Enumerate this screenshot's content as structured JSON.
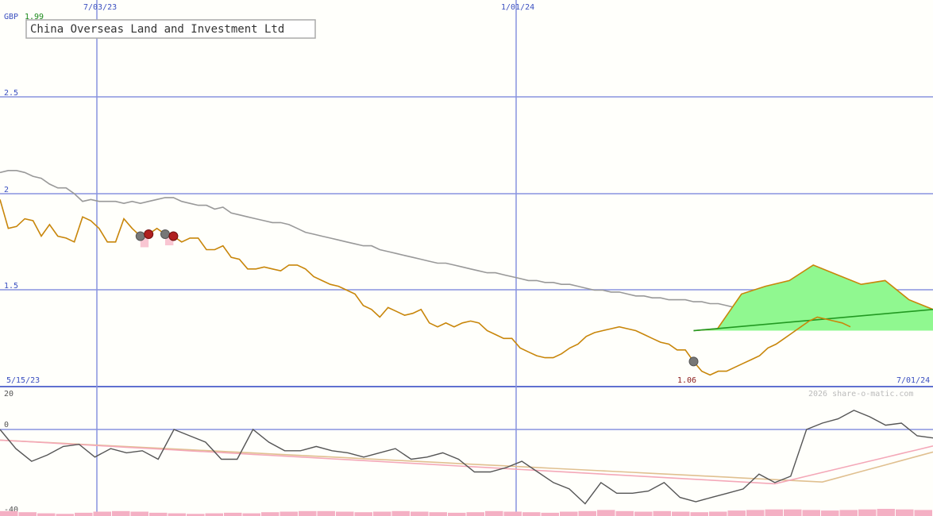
{
  "chart_data": {
    "type": "line",
    "title": "China Overseas Land and Investment Ltd",
    "currency": "GBP",
    "last_value_label": "1.99",
    "low_value_label": "1.06",
    "watermark": "2026 share-o-matic.com",
    "x_range": [
      "5/15/23",
      "7/01/24"
    ],
    "x_gridlines": [
      "7/03/23",
      "1/01/24"
    ],
    "y_ticks": [
      "2.5",
      "2",
      "1.5"
    ],
    "y_range": [
      1.0,
      2.95
    ],
    "oscillator": {
      "ticks": [
        "20",
        "0",
        "-40"
      ],
      "range": [
        -40,
        20
      ]
    },
    "colors": {
      "price": "#c8860a",
      "moving_average": "#999999",
      "forecast_fill": "#90f890",
      "trend_line": "#229922",
      "osc_fast": "#555555",
      "osc_pink": "#f4a8b8",
      "osc_tan": "#e0c090",
      "volume": "#f4b0c4",
      "grid": "#8894e0"
    },
    "series": [
      {
        "name": "price",
        "values": [
          1.97,
          1.82,
          1.83,
          1.87,
          1.86,
          1.78,
          1.84,
          1.78,
          1.77,
          1.75,
          1.88,
          1.86,
          1.82,
          1.75,
          1.75,
          1.87,
          1.82,
          1.78,
          1.79,
          1.82,
          1.79,
          1.78,
          1.75,
          1.77,
          1.77,
          1.71,
          1.71,
          1.73,
          1.67,
          1.66,
          1.61,
          1.61,
          1.62,
          1.61,
          1.6,
          1.63,
          1.63,
          1.61,
          1.57,
          1.55,
          1.53,
          1.52,
          1.5,
          1.48,
          1.42,
          1.4,
          1.36,
          1.41,
          1.39,
          1.37,
          1.38,
          1.4,
          1.33,
          1.31,
          1.33,
          1.31,
          1.33,
          1.34,
          1.33,
          1.29,
          1.27,
          1.25,
          1.25,
          1.2,
          1.18,
          1.16,
          1.15,
          1.15,
          1.17,
          1.2,
          1.22,
          1.26,
          1.28,
          1.29,
          1.3,
          1.31,
          1.3,
          1.29,
          1.27,
          1.25,
          1.23,
          1.22,
          1.19,
          1.19,
          1.13,
          1.08,
          1.06,
          1.08,
          1.08,
          1.1,
          1.12,
          1.14,
          1.16,
          1.2,
          1.22,
          1.25,
          1.28,
          1.31,
          1.34,
          1.36,
          1.35,
          1.34,
          1.33,
          1.31
        ]
      },
      {
        "name": "moving_average",
        "values": [
          2.11,
          2.12,
          2.12,
          2.11,
          2.09,
          2.08,
          2.05,
          2.03,
          2.03,
          2.0,
          1.96,
          1.97,
          1.96,
          1.96,
          1.96,
          1.95,
          1.96,
          1.95,
          1.96,
          1.97,
          1.98,
          1.98,
          1.96,
          1.95,
          1.94,
          1.94,
          1.92,
          1.93,
          1.9,
          1.89,
          1.88,
          1.87,
          1.86,
          1.85,
          1.85,
          1.84,
          1.82,
          1.8,
          1.79,
          1.78,
          1.77,
          1.76,
          1.75,
          1.74,
          1.73,
          1.73,
          1.71,
          1.7,
          1.69,
          1.68,
          1.67,
          1.66,
          1.65,
          1.64,
          1.64,
          1.63,
          1.62,
          1.61,
          1.6,
          1.59,
          1.59,
          1.58,
          1.57,
          1.56,
          1.55,
          1.55,
          1.54,
          1.54,
          1.53,
          1.53,
          1.52,
          1.51,
          1.5,
          1.5,
          1.49,
          1.49,
          1.48,
          1.47,
          1.47,
          1.46,
          1.46,
          1.45,
          1.45,
          1.45,
          1.44,
          1.44,
          1.43,
          1.43,
          1.42,
          1.41,
          1.41,
          1.4,
          1.4,
          1.4,
          1.39,
          1.39,
          1.39,
          1.38,
          1.38,
          1.38,
          1.38,
          1.38,
          1.38,
          1.38
        ]
      }
    ],
    "markers": [
      {
        "index": 17,
        "kind": "grey"
      },
      {
        "index": 18,
        "kind": "red"
      },
      {
        "index": 20,
        "kind": "grey"
      },
      {
        "index": 21,
        "kind": "red"
      },
      {
        "index": 84,
        "kind": "grey"
      }
    ],
    "forecast": {
      "start_index": 84,
      "start_value": 1.29,
      "points": [
        1.3,
        1.48,
        1.52,
        1.55,
        1.63,
        1.58,
        1.53,
        1.55,
        1.45,
        1.4
      ],
      "trend_end": 1.4
    }
  }
}
